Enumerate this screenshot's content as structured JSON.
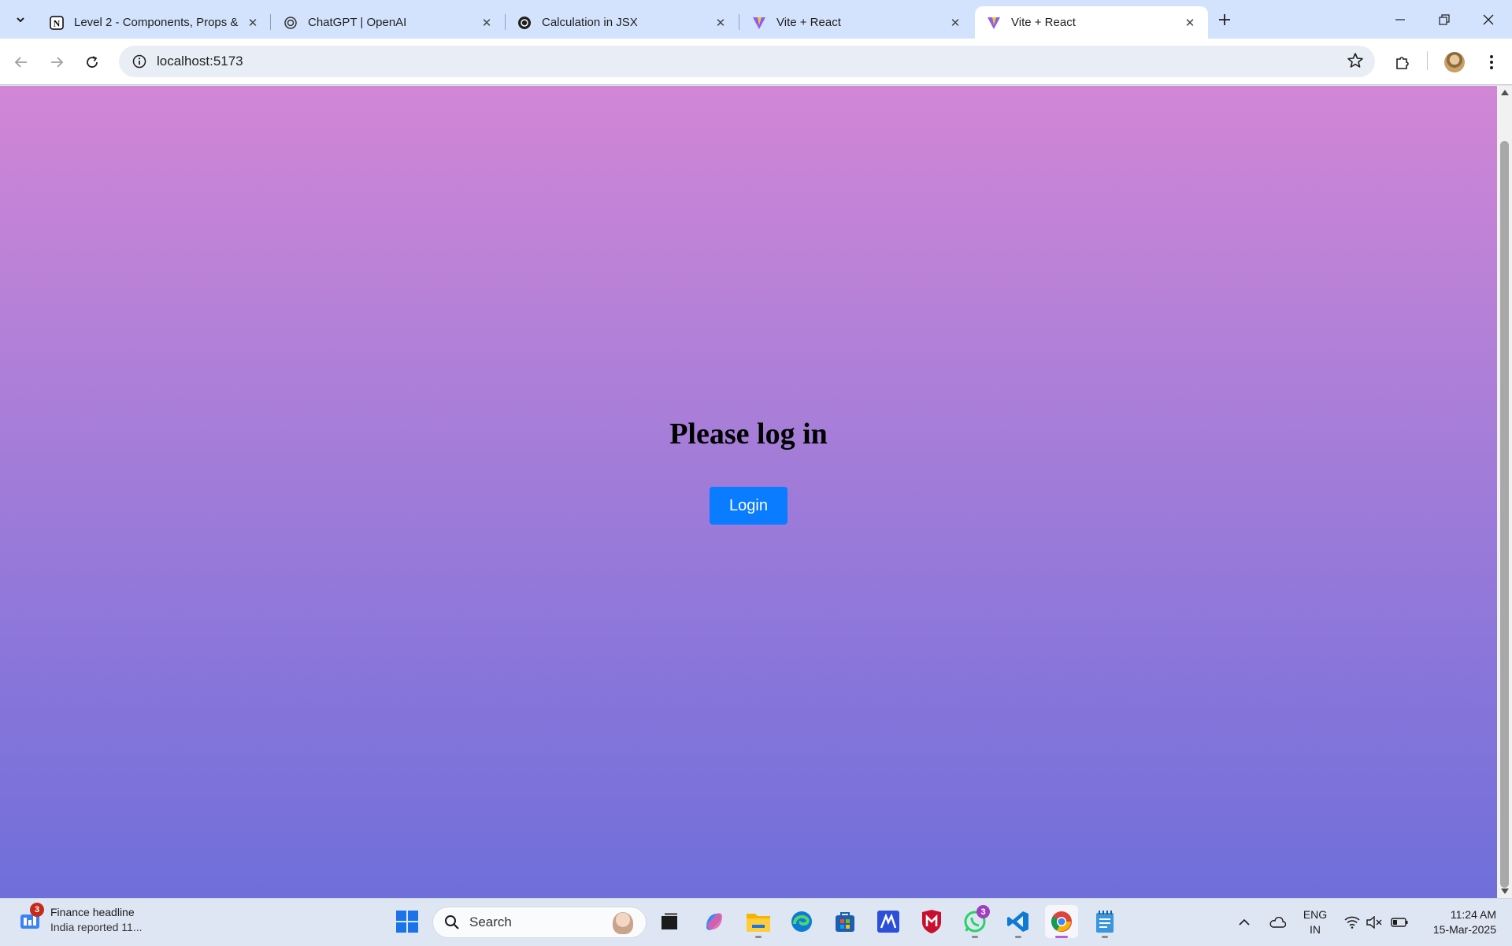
{
  "browser": {
    "tabs": [
      {
        "title": "Level 2 - Components, Props &",
        "icon": "notion-icon",
        "active": false
      },
      {
        "title": "ChatGPT | OpenAI",
        "icon": "openai-icon",
        "active": false
      },
      {
        "title": "Calculation in JSX",
        "icon": "openai-icon",
        "active": false
      },
      {
        "title": "Vite + React",
        "icon": "vite-icon",
        "active": false
      },
      {
        "title": "Vite + React",
        "icon": "vite-icon",
        "active": true
      }
    ],
    "address": "localhost:5173",
    "colors": {
      "tabstrip": "#d3e3fd",
      "omnibox": "#e9eef6"
    }
  },
  "page": {
    "heading": "Please log in",
    "login_label": "Login",
    "colors": {
      "gradient_top": "#d286d6",
      "gradient_bottom": "#6f6fda",
      "button": "#0a7cff"
    }
  },
  "taskbar": {
    "widget": {
      "badge": "3",
      "title": "Finance headline",
      "subtitle": "India reported 11..."
    },
    "search_label": "Search",
    "apps": [
      {
        "name": "start-icon"
      },
      {
        "name": "task-view-icon"
      },
      {
        "name": "copilot-icon"
      },
      {
        "name": "file-explorer-icon"
      },
      {
        "name": "edge-icon"
      },
      {
        "name": "store-icon"
      },
      {
        "name": "app-m-icon"
      },
      {
        "name": "mcafee-icon"
      },
      {
        "name": "whatsapp-icon",
        "badge": "3"
      },
      {
        "name": "vscode-icon"
      },
      {
        "name": "chrome-icon",
        "active": true
      },
      {
        "name": "notepad-icon"
      }
    ],
    "lang_line1": "ENG",
    "lang_line2": "IN",
    "time": "11:24 AM",
    "date": "15-Mar-2025"
  }
}
